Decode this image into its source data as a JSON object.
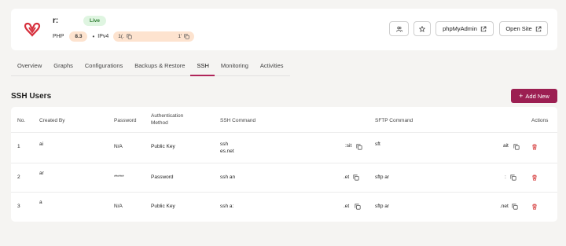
{
  "site": {
    "name": "r:",
    "status": "Live",
    "php_label": "PHP",
    "php_version": "8.3",
    "ip_label": "IPv4",
    "ip_part1": "1(.",
    "ip_part2": "1'"
  },
  "header_actions": {
    "users_icon": "users-icon",
    "star_icon": "star-icon",
    "phpmyadmin_label": "phpMyAdmin",
    "open_site_label": "Open Site"
  },
  "tabs": [
    {
      "label": "Overview"
    },
    {
      "label": "Graphs"
    },
    {
      "label": "Configurations"
    },
    {
      "label": "Backups & Restore"
    },
    {
      "label": "SSH",
      "active": true
    },
    {
      "label": "Monitoring"
    },
    {
      "label": "Activities"
    }
  ],
  "section": {
    "title": "SSH Users",
    "add_button": "Add New"
  },
  "table": {
    "headers": {
      "no": "No.",
      "created_by": "Created By",
      "password": "Password",
      "auth_line1": "Authentication",
      "auth_line2": "Method",
      "ssh_command": "SSH Command",
      "sftp_command": "SFTP Command",
      "actions": "Actions"
    },
    "rows": [
      {
        "no": "1",
        "created_by": "ai",
        "password": "N/A",
        "auth": "Public Key",
        "ssh_a": "ssh",
        "ssh_b": "es.net",
        "ssh_tail": ":sit",
        "sftp_a": "sft",
        "sftp_tail": "ait"
      },
      {
        "no": "2",
        "created_by": "ar",
        "password": "*****",
        "auth": "Password",
        "ssh_a": "ssh an",
        "ssh_b": "",
        "ssh_tail": ".et",
        "sftp_a": "sftp ar",
        "sftp_tail": ":"
      },
      {
        "no": "3",
        "created_by": "a",
        "password": "N/A",
        "auth": "Public Key",
        "ssh_a": "ssh a:",
        "ssh_b": "",
        "ssh_tail": ".et",
        "sftp_a": "sftp ar",
        "sftp_tail": ".net"
      }
    ]
  },
  "colors": {
    "accent": "#9c1f52",
    "live_bg": "#dff5e1",
    "live_text": "#2e7d32",
    "pill_bg": "#fde3cf",
    "delete": "#d32f2f"
  }
}
